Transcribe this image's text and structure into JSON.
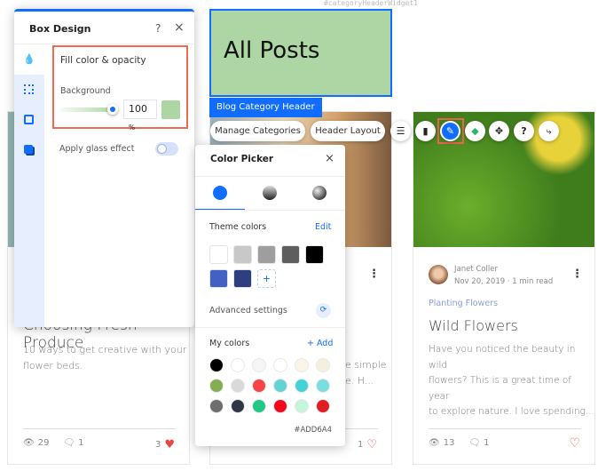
{
  "widget_id": "#categoryHeaderWidget1",
  "header_widget": {
    "title": "All Posts",
    "tag": "Blog Category Header",
    "bg_color": "#ADD6A4"
  },
  "floating_toolbar": {
    "buttons": [
      "Manage Categories",
      "Header Layout"
    ],
    "icons": [
      "settings-list-icon",
      "layout-icon",
      "design-brush-icon",
      "animation-icon",
      "stretch-icon",
      "help-icon",
      "connect-icon"
    ],
    "selected_icon": "design-brush-icon"
  },
  "box_design": {
    "title": "Box Design",
    "help": "?",
    "close": "×",
    "tabs": [
      "fill-icon",
      "border-icon",
      "corners-icon",
      "shadow-icon"
    ],
    "section_title": "Fill color & opacity",
    "background_label": "Background",
    "opacity": "100",
    "opacity_unit": "%",
    "opacity_value": 100,
    "fill_color": "#ADD6A4",
    "glass_label": "Apply glass effect",
    "glass_on": false
  },
  "color_picker": {
    "title": "Color Picker",
    "close": "×",
    "tabs": [
      "solid",
      "gradient",
      "image"
    ],
    "theme_label": "Theme colors",
    "edit": "Edit",
    "theme_colors": [
      "#FFFFFF",
      "#C8C8C8",
      "#9E9E9E",
      "#5E5E5E",
      "#000000",
      "#4361C2",
      "#2D3F80"
    ],
    "add": "+",
    "advanced": "Advanced settings",
    "my_colors_label": "My colors",
    "add_color": "+ Add",
    "my_colors": [
      "#000000",
      "#FFFFFF",
      "#F6F6F6",
      "#FFFFFF",
      "#FBF5E9",
      "#F3F0E0",
      "#83AF50",
      "#D9D9D9",
      "#F94447",
      "#63D3D4",
      "#43D3D6",
      "#7ADEDE",
      "#6E6E6E",
      "#303648",
      "#21C886",
      "#F5061D",
      "#C5F5DA",
      "#DF1E22"
    ],
    "hex": "#ADD6A4"
  },
  "posts": [
    {
      "title": "Choosing Fresh Produce",
      "excerpt": [
        "10 ways to get creative with your",
        "flower beds."
      ],
      "views": "29",
      "comments": "1",
      "likes": "3",
      "liked": true
    },
    {
      "excerpt": [
        "e simple",
        "e. H..."
      ],
      "likes": "1",
      "liked": false
    },
    {
      "author": "Janet Coller",
      "date": "Nov 20, 2019",
      "read": "1 min read",
      "category": "Planting Flowers",
      "title": "Wild Flowers",
      "excerpt": [
        "Have you noticed the beauty in wild",
        "flowers? This is a great time of year",
        "to explore nature. I love spending..."
      ],
      "views": "13",
      "comments": "1",
      "likes": "",
      "liked": false
    }
  ]
}
